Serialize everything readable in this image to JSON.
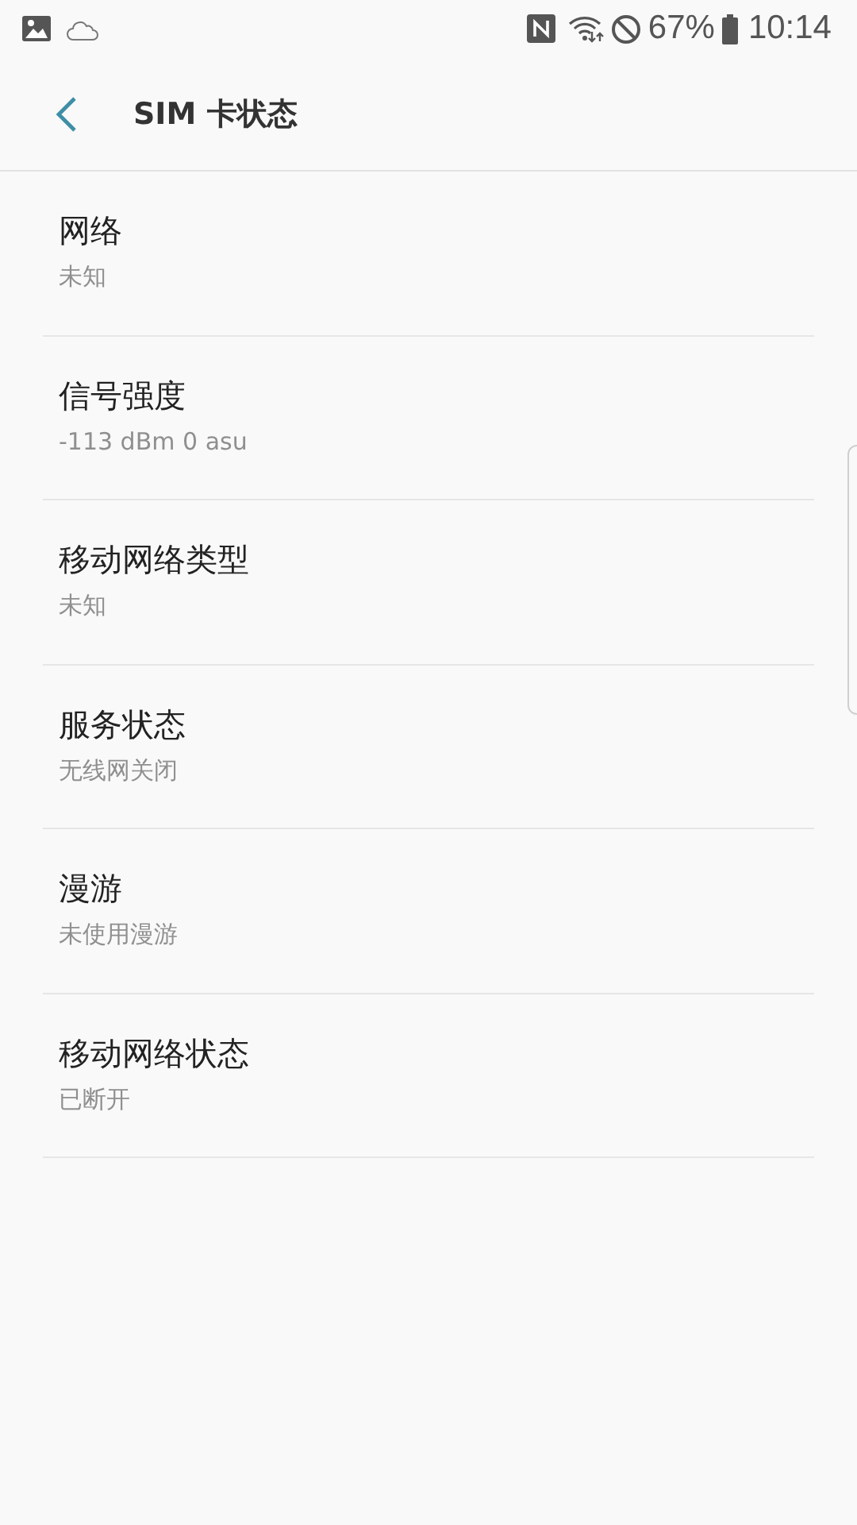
{
  "status_bar": {
    "battery": "67%",
    "time": "10:14"
  },
  "app_bar": {
    "title": "SIM 卡状态"
  },
  "items": [
    {
      "title": "网络",
      "value": "未知"
    },
    {
      "title": "信号强度",
      "value": "-113 dBm 0 asu"
    },
    {
      "title": "移动网络类型",
      "value": "未知"
    },
    {
      "title": "服务状态",
      "value": "无线网关闭"
    },
    {
      "title": "漫游",
      "value": "未使用漫游"
    },
    {
      "title": "移动网络状态",
      "value": "已断开"
    }
  ]
}
